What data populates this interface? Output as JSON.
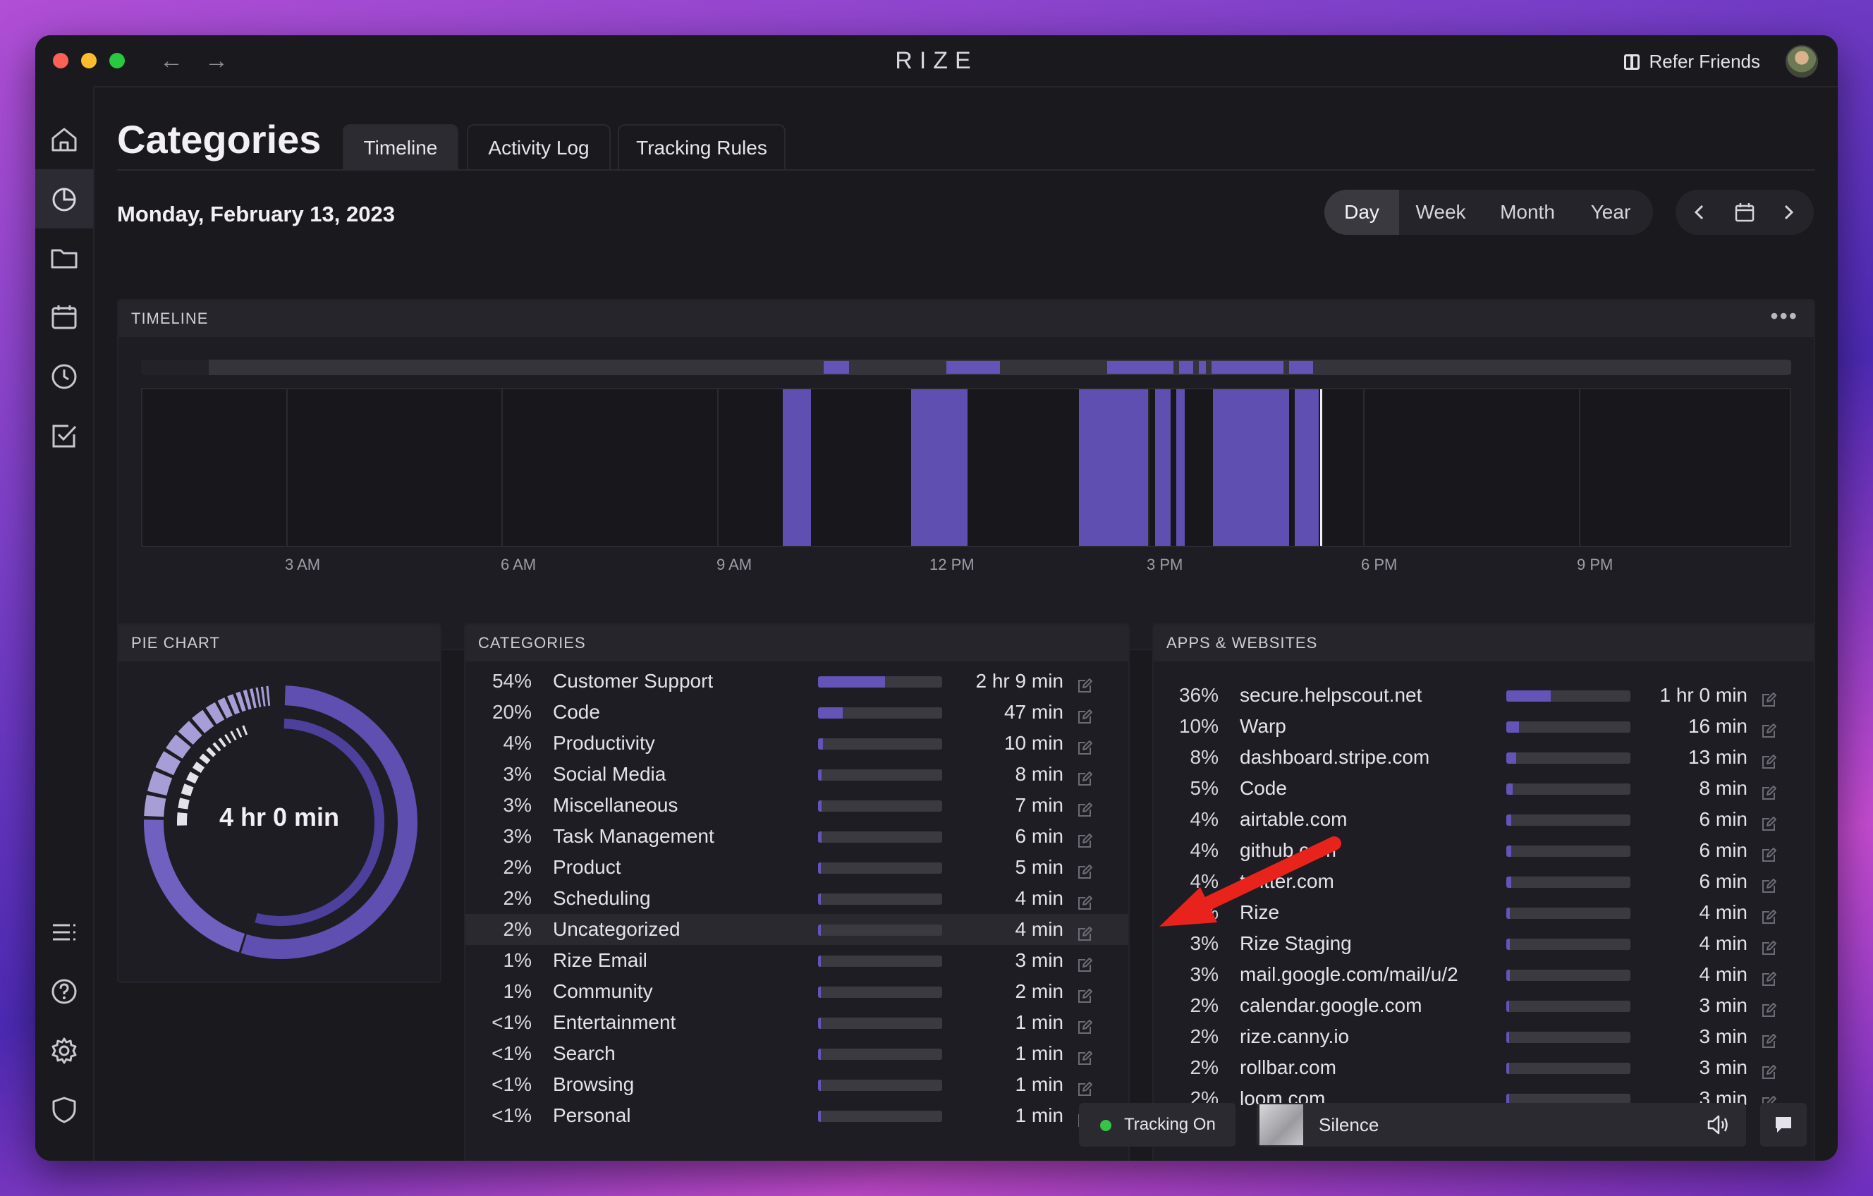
{
  "window": {
    "title": "RIZE",
    "refer_label": "Refer Friends"
  },
  "nav": {
    "back": "←",
    "forward": "→"
  },
  "page": {
    "title": "Categories",
    "tabs": [
      "Timeline",
      "Activity Log",
      "Tracking Rules"
    ],
    "active_tab": "Timeline",
    "date": "Monday, February 13, 2023"
  },
  "range": {
    "options": [
      "Day",
      "Week",
      "Month",
      "Year"
    ],
    "active": "Day"
  },
  "timeline": {
    "header": "TIMELINE",
    "axis_labels": [
      "3 AM",
      "6 AM",
      "9 AM",
      "12 PM",
      "3 PM",
      "6 PM",
      "9 PM"
    ]
  },
  "pie": {
    "header": "PIE CHART",
    "total": "4 hr 0 min"
  },
  "categories": {
    "header": "CATEGORIES",
    "rows": [
      {
        "pct": "54%",
        "name": "Customer Support",
        "time": "2 hr 9 min",
        "share": 0.54
      },
      {
        "pct": "20%",
        "name": "Code",
        "time": "47 min",
        "share": 0.2
      },
      {
        "pct": "4%",
        "name": "Productivity",
        "time": "10 min",
        "share": 0.04
      },
      {
        "pct": "3%",
        "name": "Social Media",
        "time": "8 min",
        "share": 0.03
      },
      {
        "pct": "3%",
        "name": "Miscellaneous",
        "time": "7 min",
        "share": 0.03
      },
      {
        "pct": "3%",
        "name": "Task Management",
        "time": "6 min",
        "share": 0.03
      },
      {
        "pct": "2%",
        "name": "Product",
        "time": "5 min",
        "share": 0.02
      },
      {
        "pct": "2%",
        "name": "Scheduling",
        "time": "4 min",
        "share": 0.02
      },
      {
        "pct": "2%",
        "name": "Uncategorized",
        "time": "4 min",
        "share": 0.02
      },
      {
        "pct": "1%",
        "name": "Rize Email",
        "time": "3 min",
        "share": 0.01
      },
      {
        "pct": "1%",
        "name": "Community",
        "time": "2 min",
        "share": 0.01
      },
      {
        "pct": "<1%",
        "name": "Entertainment",
        "time": "1 min",
        "share": 0.005
      },
      {
        "pct": "<1%",
        "name": "Search",
        "time": "1 min",
        "share": 0.005
      },
      {
        "pct": "<1%",
        "name": "Browsing",
        "time": "1 min",
        "share": 0.005
      },
      {
        "pct": "<1%",
        "name": "Personal",
        "time": "1 min",
        "share": 0.005
      }
    ]
  },
  "apps": {
    "header": "APPS & WEBSITES",
    "rows": [
      {
        "pct": "36%",
        "name": "secure.helpscout.net",
        "time": "1 hr 0 min",
        "share": 0.36
      },
      {
        "pct": "10%",
        "name": "Warp",
        "time": "16 min",
        "share": 0.1
      },
      {
        "pct": "8%",
        "name": "dashboard.stripe.com",
        "time": "13 min",
        "share": 0.08
      },
      {
        "pct": "5%",
        "name": "Code",
        "time": "8 min",
        "share": 0.05
      },
      {
        "pct": "4%",
        "name": "airtable.com",
        "time": "6 min",
        "share": 0.04
      },
      {
        "pct": "4%",
        "name": "github.com",
        "time": "6 min",
        "share": 0.04
      },
      {
        "pct": "4%",
        "name": "twitter.com",
        "time": "6 min",
        "share": 0.04
      },
      {
        "pct": "3%",
        "name": "Rize",
        "time": "4 min",
        "share": 0.03
      },
      {
        "pct": "3%",
        "name": "Rize Staging",
        "time": "4 min",
        "share": 0.03
      },
      {
        "pct": "3%",
        "name": "mail.google.com/mail/u/2",
        "time": "4 min",
        "share": 0.03
      },
      {
        "pct": "2%",
        "name": "calendar.google.com",
        "time": "3 min",
        "share": 0.02
      },
      {
        "pct": "2%",
        "name": "rize.canny.io",
        "time": "3 min",
        "share": 0.02
      },
      {
        "pct": "2%",
        "name": "rollbar.com",
        "time": "3 min",
        "share": 0.02
      },
      {
        "pct": "2%",
        "name": "loom.com",
        "time": "3 min",
        "share": 0.02
      }
    ]
  },
  "footer": {
    "tracking": "Tracking On",
    "track_name": "Silence"
  },
  "colors": {
    "accent": "#6454b8",
    "tracking_on": "#35c443",
    "annotation_arrow": "#e8231c"
  }
}
